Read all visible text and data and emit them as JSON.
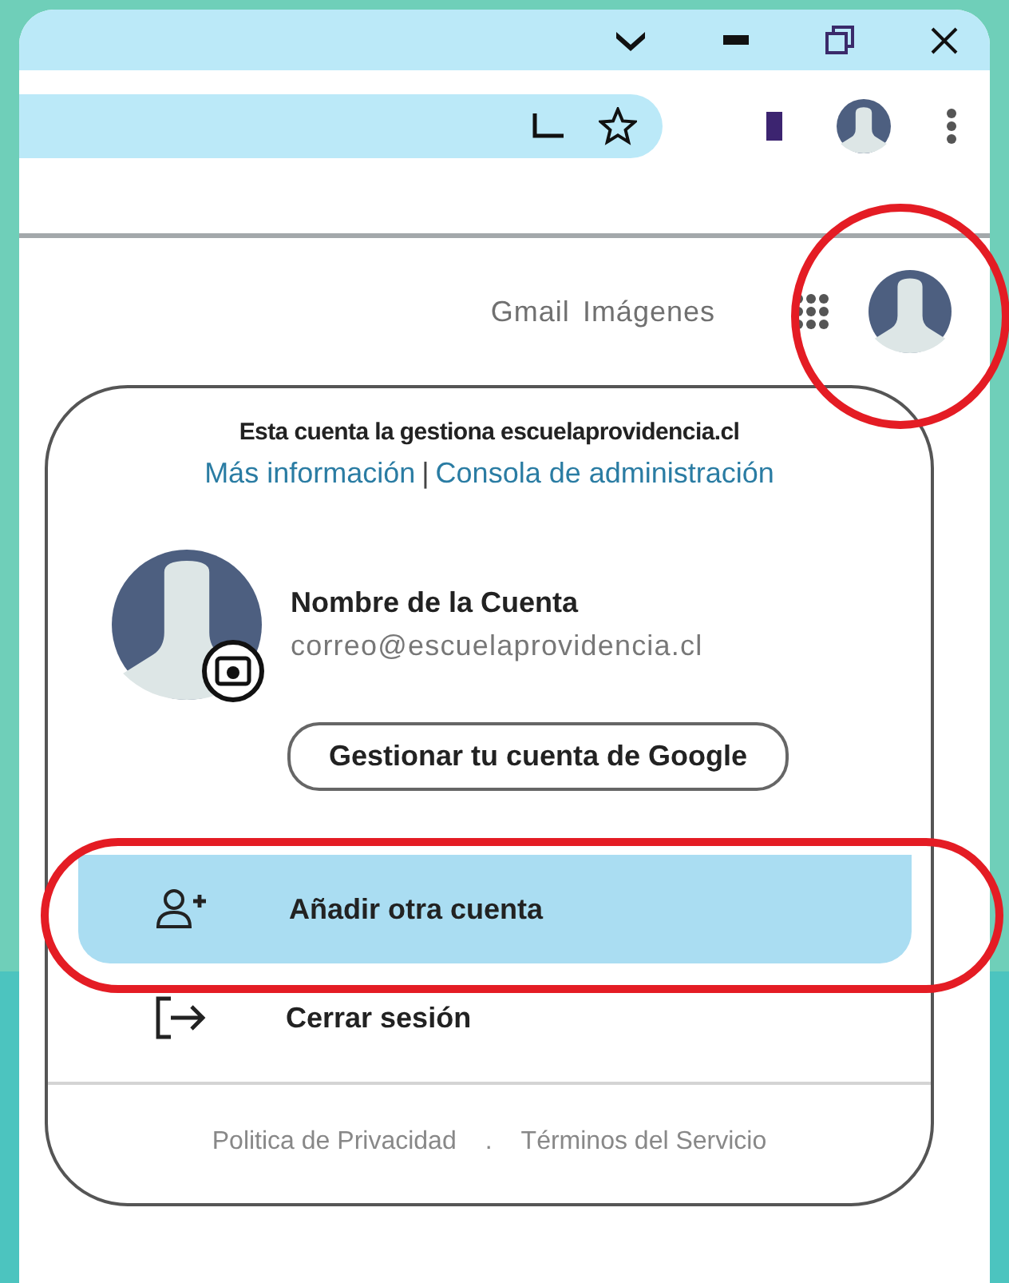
{
  "header_links": [
    "Gmail",
    "Imágenes"
  ],
  "account_menu": {
    "managed_by": "Esta cuenta la gestiona escuelaprovidencia.cl",
    "links": [
      {
        "label": "Más información"
      },
      {
        "label": "Consola de administración"
      }
    ],
    "separator": "|",
    "name": "Nombre de la Cuenta",
    "email": "correo@escuelaprovidencia.cl",
    "manage_button": "Gestionar tu cuenta de Google",
    "items": [
      {
        "kind": "add",
        "label": "Añadir otra cuenta",
        "selected": true
      },
      {
        "kind": "logout",
        "label": "Cerrar sesión",
        "selected": false
      }
    ],
    "footer": [
      "Politica de Privacidad",
      ".",
      "Términos del Servicio"
    ]
  }
}
